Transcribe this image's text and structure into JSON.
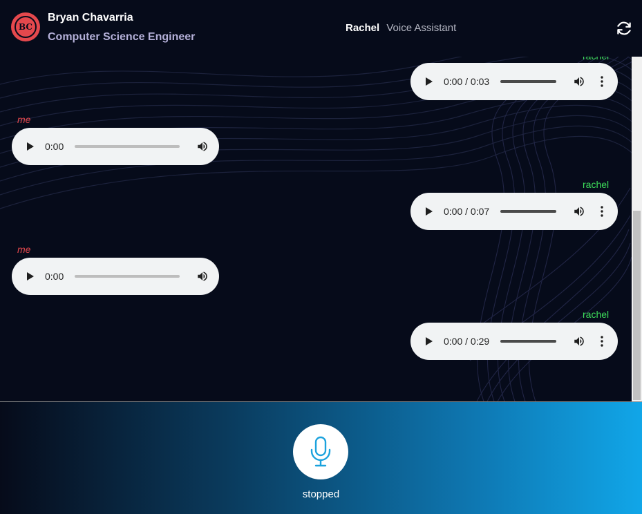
{
  "header": {
    "logo_text": "BC",
    "user_name": "Bryan Chavarria",
    "user_title": "Computer Science Engineer",
    "brand_name": "Rachel",
    "brand_subtitle": "Voice Assistant",
    "refresh_icon": "refresh-icon"
  },
  "messages": [
    {
      "sender": "rachel",
      "time": "0:00 / 0:03"
    },
    {
      "sender": "me",
      "time": "0:00"
    },
    {
      "sender": "rachel",
      "time": "0:00 / 0:07"
    },
    {
      "sender": "me",
      "time": "0:00"
    },
    {
      "sender": "rachel",
      "time": "0:00 / 0:29"
    }
  ],
  "footer": {
    "mic_icon": "microphone-icon",
    "status": "stopped"
  },
  "colors": {
    "background": "#060b1a",
    "me_label": "#e5484d",
    "rachel_label": "#3ddc5a",
    "accent": "#11a6e8"
  }
}
